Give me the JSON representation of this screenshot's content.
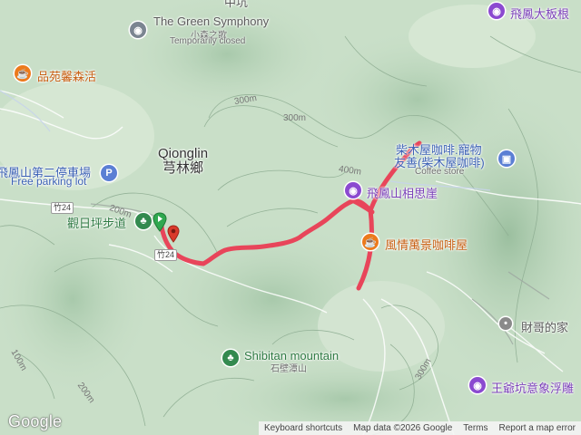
{
  "map": {
    "towns": {
      "qionglin_en": "Qionglin",
      "qionglin_zh": "芎林鄉",
      "top_partial": "中坑"
    },
    "pois": {
      "green_symphony_en": "The Green Symphony",
      "green_symphony_zh": "小森之歌",
      "green_symphony_status": "Temporarily closed",
      "pinyuan": "品苑馨森活",
      "feifeng_board": "飛鳳大板根",
      "parking_zh": "飛鳳山第二停車場",
      "parking_en": "Free parking lot",
      "guanri": "觀日坪步道",
      "chai_cafe_line1": "柴木屋咖啡.寵物",
      "chai_cafe_line2": "友善(柴木屋咖啡)",
      "coffee_store": "Coffee store",
      "xiangsiya": "飛鳳山相思崖",
      "fengqing_cafe": "風情萬景咖啡屋",
      "shibitan_en": "Shibitan mountain",
      "shibitan_zh": "石壁潭山",
      "caige": "財哥的家",
      "wangyekeng": "王爺坑意象浮雕"
    },
    "roads": {
      "route_24_a": "竹24",
      "route_24_b": "竹24"
    },
    "contours": {
      "c300_a": "300m",
      "c300_b": "300m",
      "c400": "400m",
      "c200_a": "200m",
      "c200_b": "200m",
      "c100_a": "100m",
      "c300_c": "300m"
    },
    "icons": {
      "green_symphony": "attraction-icon",
      "pinyuan": "cafe-icon",
      "feifeng_board": "attraction-icon",
      "parking": "parking-icon",
      "guanri": "park-icon",
      "chai_cafe": "shopping-bag-icon",
      "xiangsiya": "attraction-icon",
      "fengqing": "cafe-icon",
      "shibitan": "park-icon",
      "caige": "place-icon",
      "wangyekeng": "attraction-icon"
    },
    "route_color": "#e8455a",
    "start_marker_color": "#2fa84f",
    "end_marker_color": "#d93a2b"
  },
  "footer": {
    "logo": "Google",
    "keyboard_shortcuts": "Keyboard shortcuts",
    "map_data": "Map data ©2026 Google",
    "terms": "Terms",
    "report": "Report a map error"
  }
}
